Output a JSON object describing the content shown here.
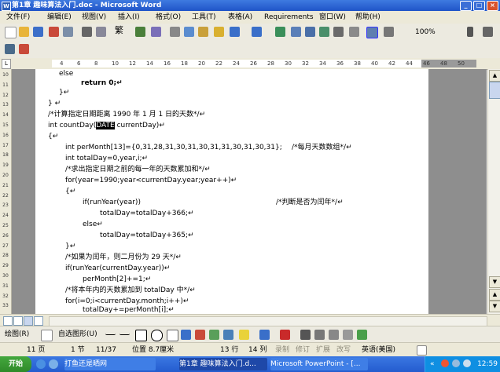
{
  "window": {
    "title": "第1章 趣味算法入门.doc - Microsoft Word",
    "app_icon": "W",
    "buttons": [
      "_",
      "□",
      "×"
    ]
  },
  "menu": [
    "文件(F)",
    "编辑(E)",
    "视图(V)",
    "插入(I)",
    "格式(O)",
    "工具(T)",
    "表格(A)",
    "Requirements",
    "窗口(W)",
    "帮助(H)"
  ],
  "toolbar": {
    "zoom": "100%",
    "traditional_label": "繁"
  },
  "ruler": {
    "corner": "L",
    "ticks": [
      "4",
      "6",
      "8",
      "10",
      "12",
      "14",
      "16",
      "18",
      "20",
      "22",
      "24",
      "26",
      "28",
      "30",
      "32",
      "34",
      "36",
      "38",
      "40",
      "42",
      "44",
      "46",
      "48",
      "50"
    ]
  },
  "vruler": {
    "ticks": [
      "10",
      "11",
      "12",
      "13",
      "14",
      "15",
      "16",
      "17",
      "18",
      "19",
      "20",
      "21",
      "22",
      "23",
      "24",
      "25",
      "26",
      "27",
      "28",
      "29",
      "30",
      "31",
      "32",
      "33"
    ]
  },
  "doc": {
    "lines": [
      {
        "text": "else"
      },
      {
        "text": "return 0;↵"
      },
      {
        "text": "}↵"
      },
      {
        "text": "}  ↵"
      },
      {
        "text": "/*计算指定日期距离 1990 年 1 月 1 日的天数*/↵"
      },
      {
        "pre": "int countDay(",
        "sel": "DATE",
        "post": " currentDay)↵"
      },
      {
        "text": "{↵"
      },
      {
        "text": "int perMonth[13]={0,31,28,31,30,31,30,31,31,30,31,30,31};"
      },
      {
        "text": "/*每月天数数组*/↵"
      },
      {
        "text": "int totalDay=0,year,i;↵"
      },
      {
        "text": "/*求出指定日期之前的每一年的天数累加和*/↵"
      },
      {
        "text": "for(year=1990;year<currentDay.year;year++)↵"
      },
      {
        "text": "{↵"
      },
      {
        "text": "if(runYear(year))"
      },
      {
        "text": "/*判断是否为闰年*/↵"
      },
      {
        "text": "totalDay=totalDay+366;↵"
      },
      {
        "text": "else↵"
      },
      {
        "text": "totalDay=totalDay+365;↵"
      },
      {
        "text": "}↵"
      },
      {
        "text": "/*如果为闰年，则二月份为 29 天*/↵"
      },
      {
        "text": "if(runYear(currentDay.year))↵"
      },
      {
        "text": "perMonth[2]+=1;↵"
      },
      {
        "text": "/*将本年内的天数累加到 totalDay 中*/↵"
      },
      {
        "text": "for(i=0;i<currentDay.month;i++)↵"
      },
      {
        "text": "totalDay+=perMonth[i];↵"
      }
    ]
  },
  "drawing": {
    "draw_label": "绘图(R)",
    "autoshape_label": "自选图形(U)"
  },
  "status": {
    "page": "11 页",
    "section": "1 节",
    "pages": "11/37",
    "position": "位置 8.7厘米",
    "line": "13 行",
    "col": "14 列",
    "rec": "录制",
    "trk": "修订",
    "ext": "扩展",
    "ovr": "改写",
    "lang": "英语(美国)"
  },
  "taskbar": {
    "start": "开始",
    "tasks": [
      "打鱼还是晒网",
      "第1章 趣味算法入门.d...",
      "Microsoft PowerPoint - [..."
    ],
    "tray_label": "«",
    "clock": "12:59"
  },
  "colors": {
    "titlebar": "#245ccf",
    "selection": "#000000",
    "squiggle": "#dd2222"
  }
}
